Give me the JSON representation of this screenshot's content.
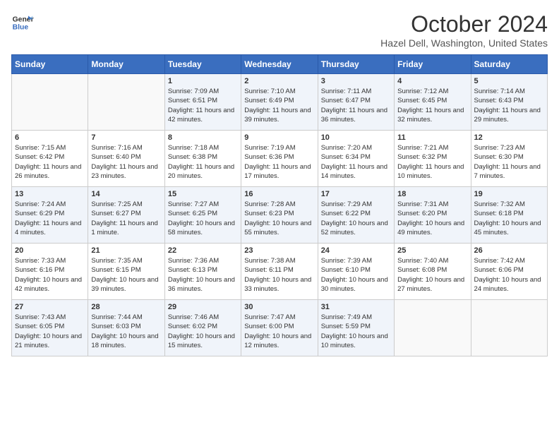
{
  "logo": {
    "line1": "General",
    "line2": "Blue"
  },
  "title": "October 2024",
  "location": "Hazel Dell, Washington, United States",
  "days_header": [
    "Sunday",
    "Monday",
    "Tuesday",
    "Wednesday",
    "Thursday",
    "Friday",
    "Saturday"
  ],
  "weeks": [
    [
      {
        "num": "",
        "sunrise": "",
        "sunset": "",
        "daylight": ""
      },
      {
        "num": "",
        "sunrise": "",
        "sunset": "",
        "daylight": ""
      },
      {
        "num": "1",
        "sunrise": "Sunrise: 7:09 AM",
        "sunset": "Sunset: 6:51 PM",
        "daylight": "Daylight: 11 hours and 42 minutes."
      },
      {
        "num": "2",
        "sunrise": "Sunrise: 7:10 AM",
        "sunset": "Sunset: 6:49 PM",
        "daylight": "Daylight: 11 hours and 39 minutes."
      },
      {
        "num": "3",
        "sunrise": "Sunrise: 7:11 AM",
        "sunset": "Sunset: 6:47 PM",
        "daylight": "Daylight: 11 hours and 36 minutes."
      },
      {
        "num": "4",
        "sunrise": "Sunrise: 7:12 AM",
        "sunset": "Sunset: 6:45 PM",
        "daylight": "Daylight: 11 hours and 32 minutes."
      },
      {
        "num": "5",
        "sunrise": "Sunrise: 7:14 AM",
        "sunset": "Sunset: 6:43 PM",
        "daylight": "Daylight: 11 hours and 29 minutes."
      }
    ],
    [
      {
        "num": "6",
        "sunrise": "Sunrise: 7:15 AM",
        "sunset": "Sunset: 6:42 PM",
        "daylight": "Daylight: 11 hours and 26 minutes."
      },
      {
        "num": "7",
        "sunrise": "Sunrise: 7:16 AM",
        "sunset": "Sunset: 6:40 PM",
        "daylight": "Daylight: 11 hours and 23 minutes."
      },
      {
        "num": "8",
        "sunrise": "Sunrise: 7:18 AM",
        "sunset": "Sunset: 6:38 PM",
        "daylight": "Daylight: 11 hours and 20 minutes."
      },
      {
        "num": "9",
        "sunrise": "Sunrise: 7:19 AM",
        "sunset": "Sunset: 6:36 PM",
        "daylight": "Daylight: 11 hours and 17 minutes."
      },
      {
        "num": "10",
        "sunrise": "Sunrise: 7:20 AM",
        "sunset": "Sunset: 6:34 PM",
        "daylight": "Daylight: 11 hours and 14 minutes."
      },
      {
        "num": "11",
        "sunrise": "Sunrise: 7:21 AM",
        "sunset": "Sunset: 6:32 PM",
        "daylight": "Daylight: 11 hours and 10 minutes."
      },
      {
        "num": "12",
        "sunrise": "Sunrise: 7:23 AM",
        "sunset": "Sunset: 6:30 PM",
        "daylight": "Daylight: 11 hours and 7 minutes."
      }
    ],
    [
      {
        "num": "13",
        "sunrise": "Sunrise: 7:24 AM",
        "sunset": "Sunset: 6:29 PM",
        "daylight": "Daylight: 11 hours and 4 minutes."
      },
      {
        "num": "14",
        "sunrise": "Sunrise: 7:25 AM",
        "sunset": "Sunset: 6:27 PM",
        "daylight": "Daylight: 11 hours and 1 minute."
      },
      {
        "num": "15",
        "sunrise": "Sunrise: 7:27 AM",
        "sunset": "Sunset: 6:25 PM",
        "daylight": "Daylight: 10 hours and 58 minutes."
      },
      {
        "num": "16",
        "sunrise": "Sunrise: 7:28 AM",
        "sunset": "Sunset: 6:23 PM",
        "daylight": "Daylight: 10 hours and 55 minutes."
      },
      {
        "num": "17",
        "sunrise": "Sunrise: 7:29 AM",
        "sunset": "Sunset: 6:22 PM",
        "daylight": "Daylight: 10 hours and 52 minutes."
      },
      {
        "num": "18",
        "sunrise": "Sunrise: 7:31 AM",
        "sunset": "Sunset: 6:20 PM",
        "daylight": "Daylight: 10 hours and 49 minutes."
      },
      {
        "num": "19",
        "sunrise": "Sunrise: 7:32 AM",
        "sunset": "Sunset: 6:18 PM",
        "daylight": "Daylight: 10 hours and 45 minutes."
      }
    ],
    [
      {
        "num": "20",
        "sunrise": "Sunrise: 7:33 AM",
        "sunset": "Sunset: 6:16 PM",
        "daylight": "Daylight: 10 hours and 42 minutes."
      },
      {
        "num": "21",
        "sunrise": "Sunrise: 7:35 AM",
        "sunset": "Sunset: 6:15 PM",
        "daylight": "Daylight: 10 hours and 39 minutes."
      },
      {
        "num": "22",
        "sunrise": "Sunrise: 7:36 AM",
        "sunset": "Sunset: 6:13 PM",
        "daylight": "Daylight: 10 hours and 36 minutes."
      },
      {
        "num": "23",
        "sunrise": "Sunrise: 7:38 AM",
        "sunset": "Sunset: 6:11 PM",
        "daylight": "Daylight: 10 hours and 33 minutes."
      },
      {
        "num": "24",
        "sunrise": "Sunrise: 7:39 AM",
        "sunset": "Sunset: 6:10 PM",
        "daylight": "Daylight: 10 hours and 30 minutes."
      },
      {
        "num": "25",
        "sunrise": "Sunrise: 7:40 AM",
        "sunset": "Sunset: 6:08 PM",
        "daylight": "Daylight: 10 hours and 27 minutes."
      },
      {
        "num": "26",
        "sunrise": "Sunrise: 7:42 AM",
        "sunset": "Sunset: 6:06 PM",
        "daylight": "Daylight: 10 hours and 24 minutes."
      }
    ],
    [
      {
        "num": "27",
        "sunrise": "Sunrise: 7:43 AM",
        "sunset": "Sunset: 6:05 PM",
        "daylight": "Daylight: 10 hours and 21 minutes."
      },
      {
        "num": "28",
        "sunrise": "Sunrise: 7:44 AM",
        "sunset": "Sunset: 6:03 PM",
        "daylight": "Daylight: 10 hours and 18 minutes."
      },
      {
        "num": "29",
        "sunrise": "Sunrise: 7:46 AM",
        "sunset": "Sunset: 6:02 PM",
        "daylight": "Daylight: 10 hours and 15 minutes."
      },
      {
        "num": "30",
        "sunrise": "Sunrise: 7:47 AM",
        "sunset": "Sunset: 6:00 PM",
        "daylight": "Daylight: 10 hours and 12 minutes."
      },
      {
        "num": "31",
        "sunrise": "Sunrise: 7:49 AM",
        "sunset": "Sunset: 5:59 PM",
        "daylight": "Daylight: 10 hours and 10 minutes."
      },
      {
        "num": "",
        "sunrise": "",
        "sunset": "",
        "daylight": ""
      },
      {
        "num": "",
        "sunrise": "",
        "sunset": "",
        "daylight": ""
      }
    ]
  ]
}
